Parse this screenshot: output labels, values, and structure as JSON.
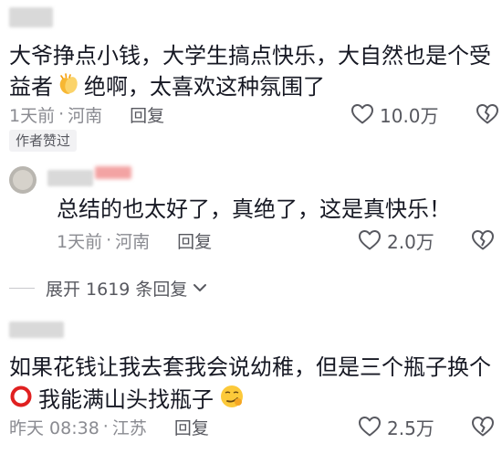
{
  "comment1": {
    "text_line1": "大爷挣点小钱，大学生搞点快乐，大自然也是个受",
    "text_line2_prefix": "益者",
    "text_line2_suffix": "绝啊，太喜欢这种氛围了",
    "time": "1天前",
    "location": "河南",
    "reply_label": "回复",
    "like_count": "10.0万",
    "badge": "作者赞过"
  },
  "reply1": {
    "text": "总结的也太好了，真绝了，这是真快乐！",
    "time": "1天前",
    "location": "河南",
    "reply_label": "回复",
    "like_count": "2.0万"
  },
  "expand": {
    "label": "展开 1619 条回复"
  },
  "comment2": {
    "text_line1": "如果花钱让我去套我会说幼稚，但是三个瓶子换个",
    "text_line2": "我能满山头找瓶子",
    "time": "昨天 08:38",
    "location": "江苏",
    "reply_label": "回复",
    "like_count": "2.5万"
  },
  "icons": {
    "clap": "clapping-hands-icon",
    "heart": "heart-outline-icon",
    "broken_heart": "broken-heart-icon",
    "circle": "heavy-large-circle-icon",
    "smirk": "smirking-face-icon",
    "chevron": "chevron-down-icon"
  },
  "colors": {
    "red_circle": "#e02020",
    "muted": "#8a8b91",
    "text": "#161823"
  }
}
